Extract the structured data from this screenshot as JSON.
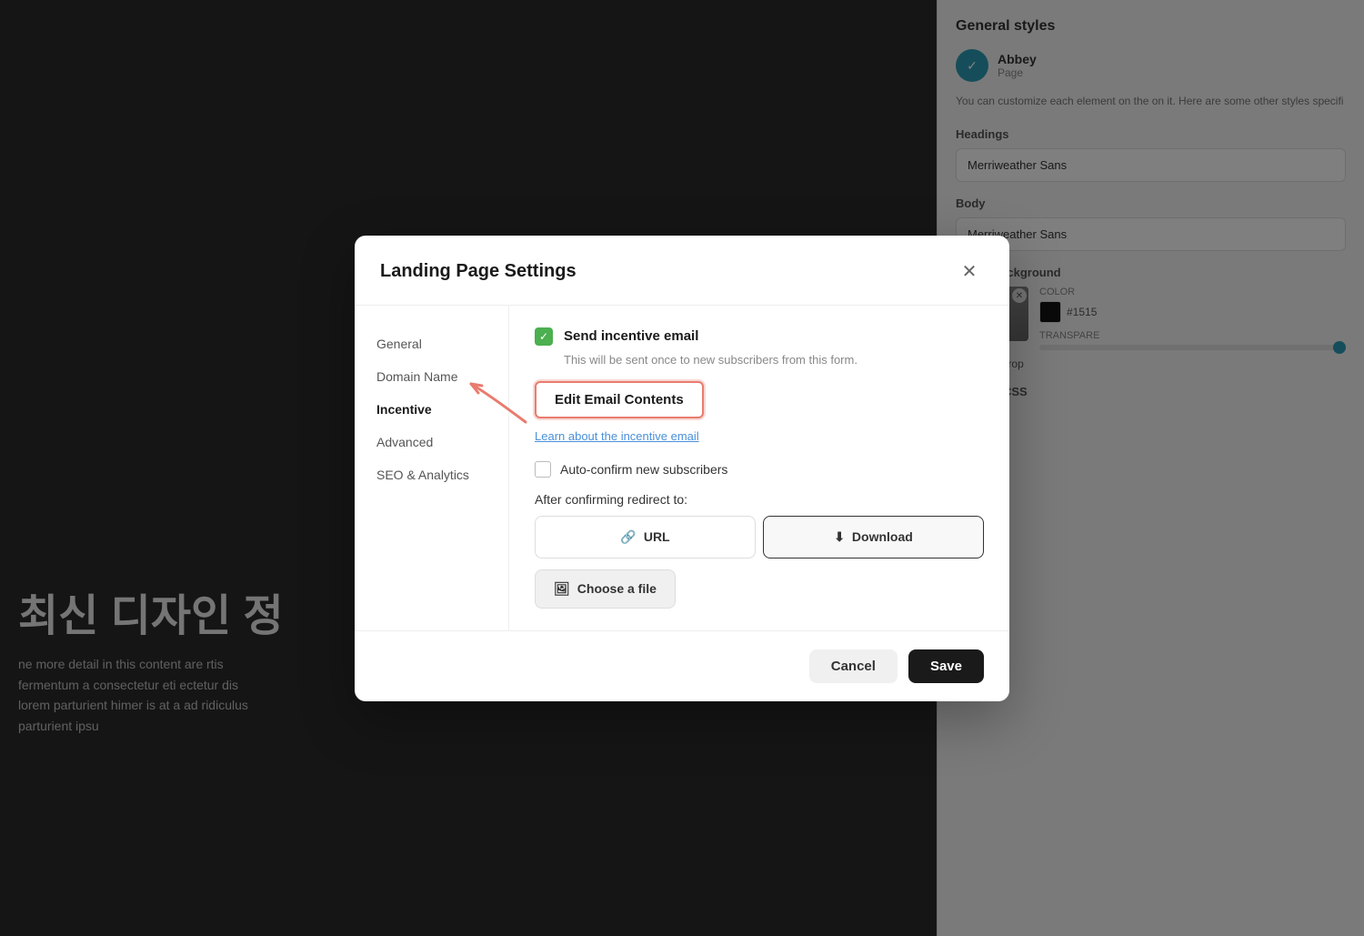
{
  "background": {
    "korean_title": "최신 디자인 정",
    "body_text": "ne more detail in this content are\nrtis fermentum a consectetur eti\nectetur dis lorem parturient himer\nis at a ad ridiculus parturient ipsu"
  },
  "sidebar": {
    "title": "General styles",
    "theme": {
      "name": "Abbey",
      "type": "Page"
    },
    "description": "You can customize each element on the\non it. Here are some other styles specifi",
    "headings_label": "Headings",
    "headings_font": "Merriweather Sans",
    "body_label": "Body",
    "body_font": "Merriweather Sans",
    "image_bg_label": "Image background",
    "color_label": "COLOR",
    "color_value": "#1515",
    "transparency_label": "TRANSPARE",
    "edit_crop_label": "Edit & crop",
    "custom_css_label": "Custom CSS"
  },
  "dialog": {
    "title": "Landing Page Settings",
    "nav_items": [
      {
        "label": "General",
        "active": false
      },
      {
        "label": "Domain Name",
        "active": false
      },
      {
        "label": "Incentive",
        "active": true
      },
      {
        "label": "Advanced",
        "active": false
      },
      {
        "label": "SEO & Analytics",
        "active": false
      }
    ],
    "incentive": {
      "send_email_label": "Send incentive email",
      "send_email_desc": "This will be sent once to new subscribers from this form.",
      "edit_email_btn": "Edit Email Contents",
      "learn_link": "Learn about the incentive email",
      "auto_confirm_label": "Auto-confirm new subscribers",
      "redirect_label": "After confirming redirect to:",
      "url_btn": "URL",
      "download_btn": "Download",
      "choose_file_btn": "Choose a file"
    },
    "footer": {
      "cancel_label": "Cancel",
      "save_label": "Save"
    }
  }
}
